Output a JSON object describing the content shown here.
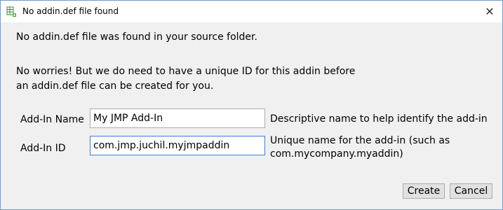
{
  "window": {
    "title": "No addin.def file found",
    "close_symbol": "✕"
  },
  "message": {
    "line1": "No addin.def file was found in your source folder.",
    "line2": "No worries! But we do need to have a unique ID for this addin before",
    "line3": "an addin.def file can be created for you."
  },
  "form": {
    "name_label": "Add-In Name",
    "name_value": "My JMP Add-In",
    "name_desc": "Descriptive name to help identify the add-in",
    "id_label": "Add-In ID",
    "id_value": "com.jmp.juchil.myjmpaddin",
    "id_desc_line1": "Unique name for the add-in (such as",
    "id_desc_line2": "com.mycompany.myaddin)"
  },
  "buttons": {
    "create": "Create",
    "cancel": "Cancel"
  },
  "icons": {
    "app": "spreadsheet-script-icon",
    "close": "close-icon"
  },
  "colors": {
    "client_bg": "#f0f0f0",
    "focus_border": "#3d7fd1"
  }
}
